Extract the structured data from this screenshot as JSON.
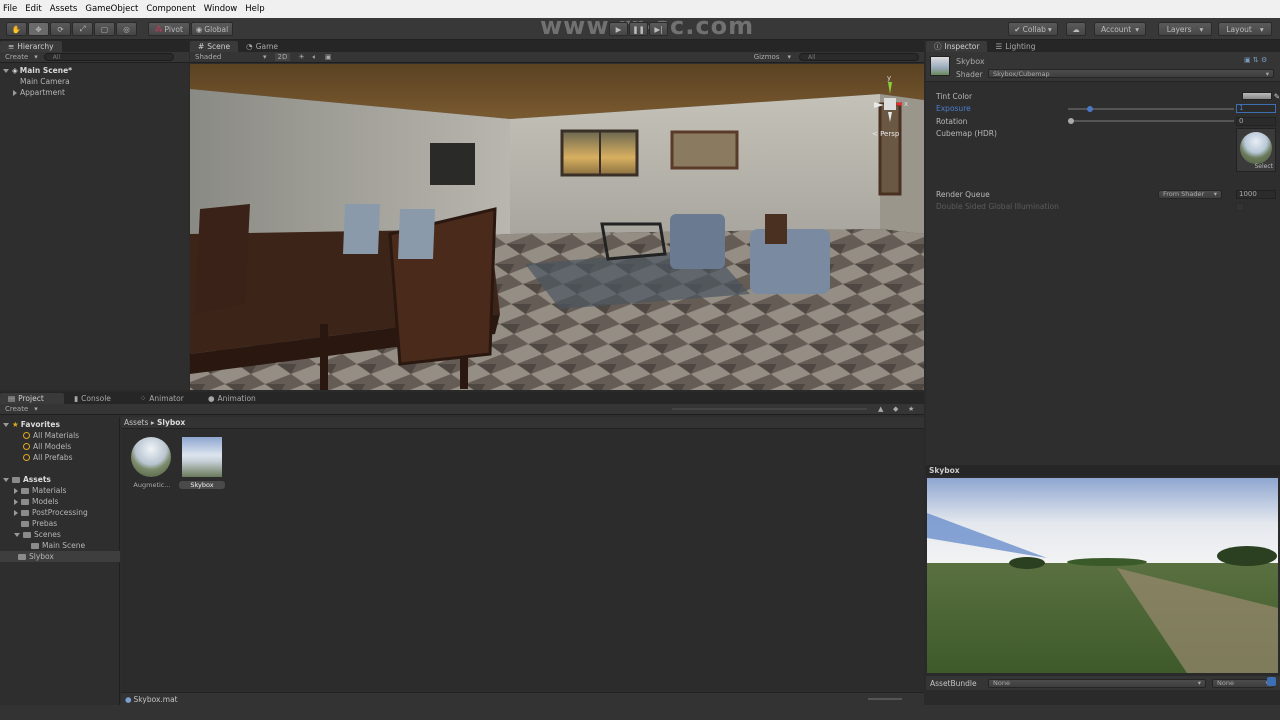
{
  "menu": [
    "File",
    "Edit",
    "Assets",
    "GameObject",
    "Component",
    "Window",
    "Help"
  ],
  "toolbar": {
    "pivot": "Pivot",
    "global": "Global",
    "collab": "Collab",
    "account": "Account",
    "layers": "Layers",
    "layout": "Layout"
  },
  "watermark_top": "www.rr-sc.com",
  "hierarchy": {
    "tab": "Hierarchy",
    "create": "Create",
    "search_placeholder": "All",
    "scene": "Main Scene*",
    "items": [
      "Main Camera",
      "Appartment"
    ]
  },
  "scene_view": {
    "tabs": [
      "Scene",
      "Game"
    ],
    "shading": "Shaded",
    "mode2d": "2D",
    "gizmos": "Gizmos",
    "search_placeholder": "All",
    "persp": "< Persp"
  },
  "inspector": {
    "tabs": [
      "Inspector",
      "Lighting"
    ],
    "name": "Skybox",
    "shader_label": "Shader",
    "shader_value": "Skybox/Cubemap",
    "tint_label": "Tint Color",
    "exposure_label": "Exposure",
    "exposure_value": "1",
    "rotation_label": "Rotation",
    "rotation_value": "0",
    "cubemap_label": "Cubemap   (HDR)",
    "select": "Select",
    "render_queue_label": "Render Queue",
    "render_queue_mode": "From Shader",
    "render_queue_value": "1000",
    "double_sided": "Double Sided Global Illumination",
    "preview_title": "Skybox",
    "assetbundle_label": "AssetBundle",
    "assetbundle_value": "None",
    "assetbundle_variant": "None"
  },
  "project": {
    "tabs": [
      "Project",
      "Console",
      "Animator",
      "Animation"
    ],
    "create": "Create",
    "favorites": "Favorites",
    "favorites_items": [
      "All Materials",
      "All Models",
      "All Prefabs"
    ],
    "assets": "Assets",
    "asset_folders": [
      "Materials",
      "Models",
      "PostProcessing",
      "Prebas",
      "Scenes"
    ],
    "scenes_child": "Main Scene",
    "slybox": "Slybox",
    "breadcrumb_root": "Assets",
    "breadcrumb_sep": "▸",
    "breadcrumb_current": "Slybox",
    "files": [
      "Augmetic...",
      "Skybox"
    ],
    "status_file": "Skybox.mat"
  },
  "colors": {
    "accent_blue": "#3d6fb5",
    "panel_bg": "#2e2e2e",
    "menubar_bg": "#f0f0f0"
  }
}
